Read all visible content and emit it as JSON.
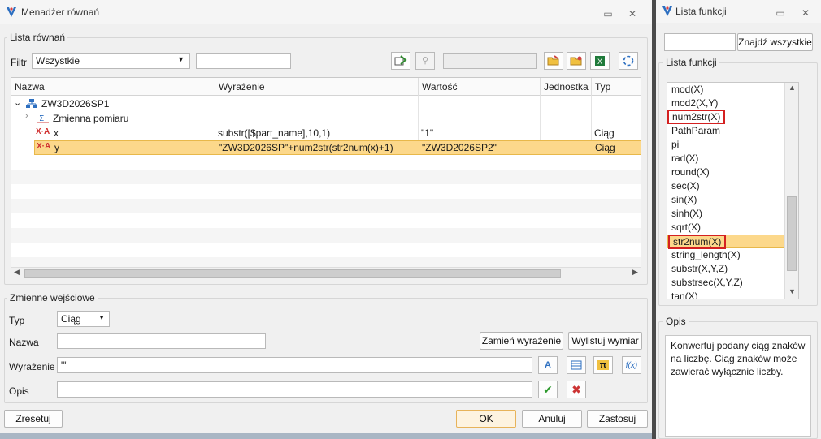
{
  "main": {
    "title": "Menadżer równań",
    "equations_group": "Lista równań",
    "filter_label": "Filtr",
    "filter_value": "Wszystkie",
    "columns": [
      "Nazwa",
      "Wyrażenie",
      "Wartość",
      "Jednostka",
      "Typ"
    ],
    "tree": {
      "root": "ZW3D2026SP1",
      "child": "Zmienna pomiaru"
    },
    "rows": [
      {
        "name": "x",
        "expr": "substr([$part_name],10,1)",
        "value": "\"1\"",
        "unit": "",
        "type": "Ciąg"
      },
      {
        "name": "y",
        "expr": "\"ZW3D2026SP\"+num2str(str2num(x)+1)",
        "value": "\"ZW3D2026SP2\"",
        "unit": "",
        "type": "Ciąg"
      }
    ],
    "input_group": "Zmienne wejściowe",
    "type_label": "Typ",
    "type_value": "Ciąg",
    "name_label": "Nazwa",
    "name_value": "",
    "expr_label": "Wyrażenie",
    "expr_value": "\"\"",
    "desc_label": "Opis",
    "desc_value": "",
    "replace_btn": "Zamień wyrażenie",
    "list_dim_btn": "Wylistuj wymiar",
    "reset_btn": "Zresetuj",
    "ok_btn": "OK",
    "cancel_btn": "Anuluj",
    "apply_btn": "Zastosuj"
  },
  "side": {
    "title": "Lista funkcji",
    "search_value": "",
    "find_all_btn": "Znajdź wszystkie",
    "list_group": "Lista funkcji",
    "functions": [
      "mod(X)",
      "mod2(X,Y)",
      "num2str(X)",
      "PathParam",
      "pi",
      "rad(X)",
      "round(X)",
      "sec(X)",
      "sin(X)",
      "sinh(X)",
      "sqrt(X)",
      "str2num(X)",
      "string_length(X)",
      "substr(X,Y,Z)",
      "substrsec(X,Y,Z)",
      "tan(X)"
    ],
    "desc_group": "Opis",
    "description": "Konwertuj podany ciąg znaków na liczbę. Ciąg znaków może zawierać wyłącznie liczby."
  },
  "colors": {
    "selection": "#fcd88b",
    "highlight_box": "#d42020",
    "accent_blue": "#2d6fc0"
  }
}
